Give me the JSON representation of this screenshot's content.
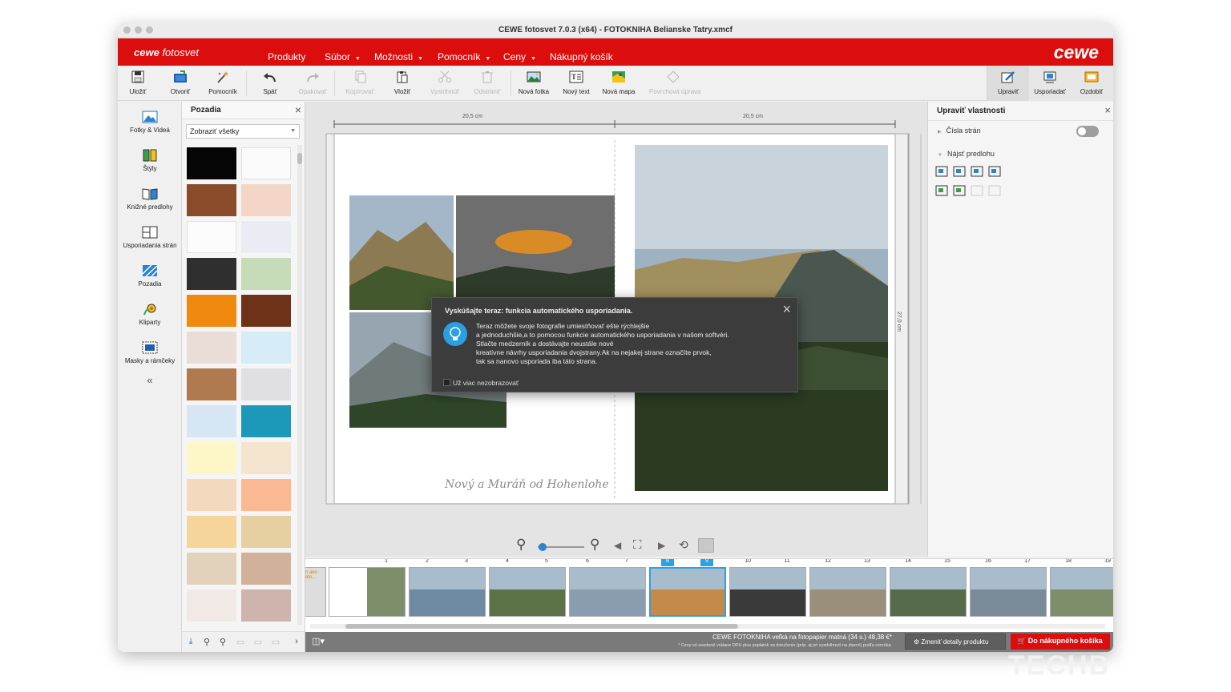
{
  "window": {
    "title": "CEWE fotosvet 7.0.3 (x64) -  FOTOKNIHA Belianske Tatry.xmcf"
  },
  "header": {
    "logo_script": "cewe",
    "logo_text": "fotosvet",
    "brand": "cewe",
    "menu": [
      {
        "label": "Produkty",
        "has_caret": false
      },
      {
        "label": "Súbor",
        "has_caret": true
      },
      {
        "label": "Možnosti",
        "has_caret": true
      },
      {
        "label": "Pomocník",
        "has_caret": true
      },
      {
        "label": "Ceny",
        "has_caret": true
      },
      {
        "label": "Nákupný košík",
        "has_caret": false
      }
    ],
    "accent_color": "#dc0d0d"
  },
  "toolbar": {
    "items": [
      {
        "label": "Uložiť",
        "icon": "save-icon",
        "enabled": true
      },
      {
        "label": "Otvoriť",
        "icon": "open-icon",
        "enabled": true
      },
      {
        "label": "Pomocník",
        "icon": "wand-icon",
        "enabled": true
      },
      {
        "label": "Späť",
        "icon": "undo-icon",
        "enabled": true
      },
      {
        "label": "Opakovať",
        "icon": "redo-icon",
        "enabled": false
      },
      {
        "label": "Kopírovať",
        "icon": "copy-icon",
        "enabled": false
      },
      {
        "label": "Vložiť",
        "icon": "paste-icon",
        "enabled": true
      },
      {
        "label": "Vystrihnúť",
        "icon": "cut-icon",
        "enabled": false
      },
      {
        "label": "Odstrániť",
        "icon": "delete-icon",
        "enabled": false
      },
      {
        "label": "Nová fotka",
        "icon": "new-photo-icon",
        "enabled": true
      },
      {
        "label": "Nový text",
        "icon": "new-text-icon",
        "enabled": true
      },
      {
        "label": "Nová mapa",
        "icon": "new-map-icon",
        "enabled": true
      },
      {
        "label": "Povrchová úprava",
        "icon": "surface-finish-icon",
        "enabled": false
      }
    ],
    "right_items": [
      {
        "label": "Upraviť",
        "icon": "edit-icon"
      },
      {
        "label": "Usporiadať",
        "icon": "arrange-icon"
      },
      {
        "label": "Ozdobiť",
        "icon": "decorate-icon"
      }
    ]
  },
  "leftnav": {
    "items": [
      {
        "label": "Fotky & Videá",
        "icon": "photos-icon"
      },
      {
        "label": "Štýly",
        "icon": "styles-icon"
      },
      {
        "label": "Knižné predlohy",
        "icon": "book-templates-icon"
      },
      {
        "label": "Usporiadania strán",
        "icon": "page-layouts-icon"
      },
      {
        "label": "Pozadia",
        "icon": "backgrounds-icon"
      },
      {
        "label": "Kliparty",
        "icon": "cliparts-icon"
      },
      {
        "label": "Masky a rámčeky",
        "icon": "masks-frames-icon"
      }
    ],
    "collapse": "«"
  },
  "backgrounds_panel": {
    "title": "Pozadia",
    "filter_value": "Zobraziť všetky",
    "swatch_colors": [
      "#050505",
      "#fbfbfb",
      "#8a4b2a",
      "#f4d6c8",
      "#fcfcfc",
      "#e9ecf2",
      "#2f2f2f",
      "#c6dcb8",
      "#f08a0e",
      "#6e3218",
      "#eadcd6",
      "#d6ecf6",
      "#b07a4e",
      "#e0e0e4",
      "#d6e6f4",
      "#1e98b8",
      "#fdf7c8",
      "#f5e5d0",
      "#f3d9bd",
      "#fab993",
      "#f5d59a",
      "#e6cfa0",
      "#e2d2bc",
      "#d1b19a",
      "#f1e9e6",
      "#cfb3ad",
      "#c49a84",
      "#e6e6ea"
    ]
  },
  "canvas": {
    "ruler_left": "20,5 cm",
    "ruler_right": "20,5 cm",
    "ruler_vertical": "27,0 cm",
    "page_caption": "Nový a Muráň od Hohenlohe"
  },
  "popup": {
    "title": "Vyskúšajte teraz: funkcia automatického usporiadania.",
    "lines": [
      "Teraz môžete svoje fotografie umiestňovať ešte rýchlejšie",
      "a jednoduchšie,a to pomocou funkcie automatického usporiadania v našom softvéri.",
      "Stlačte medzerník a dostávajte neustále nové",
      "kreatívne návrhy usporiadania dvojstrany.Ak na nejakej strane označíte prvok,",
      "tak sa nanovo usporiada iba táto strana."
    ],
    "checkbox_label": "Už viac nezobrazovať",
    "checkbox_checked": false
  },
  "properties_panel": {
    "title": "Upraviť vlastnosti",
    "page_numbers_label": "Čísla strán",
    "page_numbers_on": false,
    "find_template_label": "Nájsť predlohu"
  },
  "zoom": {
    "level": 0.1
  },
  "filmstrip": {
    "page_numbers": [
      "1",
      "2",
      "3",
      "4",
      "5",
      "6",
      "7",
      "8",
      "9",
      "10",
      "11",
      "12",
      "13",
      "14",
      "15",
      "16",
      "17",
      "18",
      "19"
    ],
    "selected": [
      "8",
      "9"
    ],
    "first_thumb_text": "n ako\nelo..."
  },
  "status": {
    "product_line": "CEWE FOTOKNIHA veľká na fotopapier matná (34 s.) 48,38 €*",
    "note_line": "* Ceny sú uvedené vrátane DPH plus poplatok za doručenie (príp. aj pri vyzdvihnutí na zberni) podľa cenníka.",
    "change_details": "Zmeniť detaily produktu",
    "cart_button": "Do nákupného košíka"
  },
  "watermark": "TECHB"
}
